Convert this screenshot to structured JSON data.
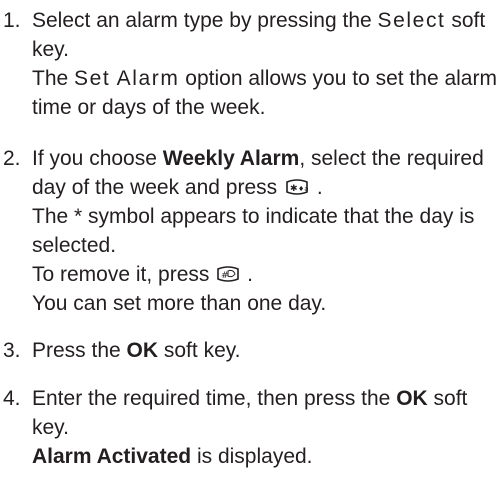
{
  "steps": [
    {
      "number": "1.",
      "line1_pre": "Select an alarm type by pressing the ",
      "line1_ui": "Select",
      "line1_post": " soft",
      "line2": "key.",
      "line3_pre": "The ",
      "line3_ui": "Set Alarm",
      "line3_post": " option allows you to set the alarm",
      "line4": "time or days of the week."
    },
    {
      "number": "2.",
      "line1_pre": "If you choose ",
      "line1_bold": "Weekly Alarm",
      "line1_post": ", select the required",
      "line2_pre": "day of the week and press ",
      "line2_key_icon": "star-key-icon",
      "line2_post": " .",
      "line3": "The * symbol appears to indicate that the day is",
      "line4": "selected.",
      "line5_pre": "To remove it, press ",
      "line5_key_icon": "hash-key-icon",
      "line5_post": " .",
      "line6": "You can set more than one day."
    },
    {
      "number": "3.",
      "line1_pre": "Press the ",
      "line1_bold": "OK",
      "line1_post": " soft key."
    },
    {
      "number": "4.",
      "line1_pre": "Enter the required time, then press the ",
      "line1_bold": "OK",
      "line1_post": " soft",
      "line2": "key.",
      "line3_bold": "Alarm Activated",
      "line3_post": " is displayed."
    }
  ]
}
